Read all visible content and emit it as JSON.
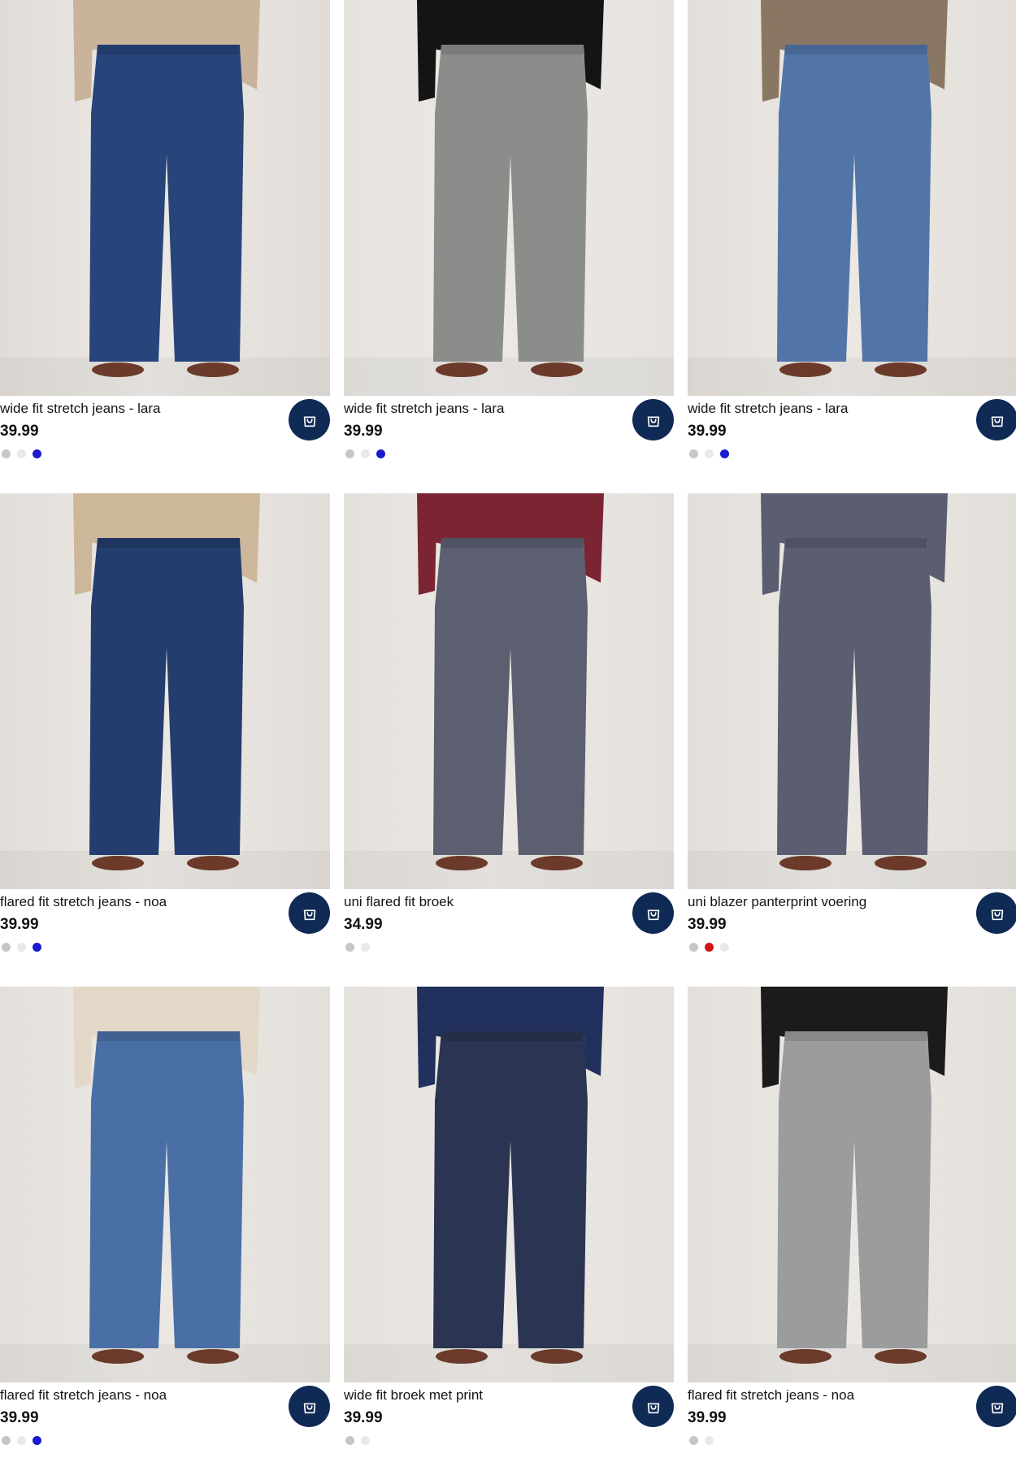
{
  "products": [
    {
      "name": "wide fit stretch jeans - lara",
      "price": "39.99",
      "cart_icon": "shopping-bag-icon",
      "swatches": [
        "#c6c6c6",
        "#e9e9ea",
        "#1a1ad0"
      ],
      "pant_color": "#27457a",
      "top_color": "#c9b39a",
      "bg": "#e1dcd7"
    },
    {
      "name": "wide fit stretch jeans - lara",
      "price": "39.99",
      "cart_icon": "shopping-bag-icon",
      "swatches": [
        "#c6c6c6",
        "#e9e9ea",
        "#1a1ad0"
      ],
      "pant_color": "#8b8d8b",
      "top_color": "#141414",
      "bg": "#e6e3df"
    },
    {
      "name": "wide fit stretch jeans - lara",
      "price": "39.99",
      "cart_icon": "shopping-bag-icon",
      "swatches": [
        "#c6c6c6",
        "#e9e9ea",
        "#1a1ad0"
      ],
      "pant_color": "#5275a8",
      "top_color": "#8a7763",
      "bg": "#e3deda"
    },
    {
      "name": "flared fit stretch jeans - noa",
      "price": "39.99",
      "cart_icon": "shopping-bag-icon",
      "swatches": [
        "#c6c6c6",
        "#e9e9ea",
        "#1a1ad0"
      ],
      "pant_color": "#233d6e",
      "top_color": "#cdb79b",
      "bg": "#e2ddd8"
    },
    {
      "name": "uni flared fit broek",
      "price": "34.99",
      "cart_icon": "shopping-bag-icon",
      "swatches": [
        "#c6c6c6",
        "#e9e9ea"
      ],
      "pant_color": "#5b5f70",
      "top_color": "#7b2433",
      "bg": "#e4e0dc"
    },
    {
      "name": "uni blazer panterprint voering",
      "price": "39.99",
      "cart_icon": "shopping-bag-icon",
      "swatches": [
        "#c6c6c6",
        "#d51414",
        "#e9e9ea"
      ],
      "pant_color": "#5a5e70",
      "top_color": "#5a5e70",
      "bg": "#e2deda"
    },
    {
      "name": "flared fit stretch jeans - noa",
      "price": "39.99",
      "cart_icon": "shopping-bag-icon",
      "swatches": [
        "#c6c6c6",
        "#e9e9ea",
        "#1a1ad0"
      ],
      "pant_color": "#4a6fa6",
      "top_color": "#e3d8c8",
      "bg": "#e3dfdb"
    },
    {
      "name": "wide fit broek met print",
      "price": "39.99",
      "cart_icon": "shopping-bag-icon",
      "swatches": [
        "#c6c6c6",
        "#e9e9ea"
      ],
      "pant_color": "#2b3553",
      "top_color": "#22305e",
      "bg": "#e5e1dd"
    },
    {
      "name": "flared fit stretch jeans - noa",
      "price": "39.99",
      "cart_icon": "shopping-bag-icon",
      "swatches": [
        "#c6c6c6",
        "#e9e9ea"
      ],
      "pant_color": "#9a9c9d",
      "top_color": "#1b1b1b",
      "bg": "#e3dfdb"
    }
  ]
}
